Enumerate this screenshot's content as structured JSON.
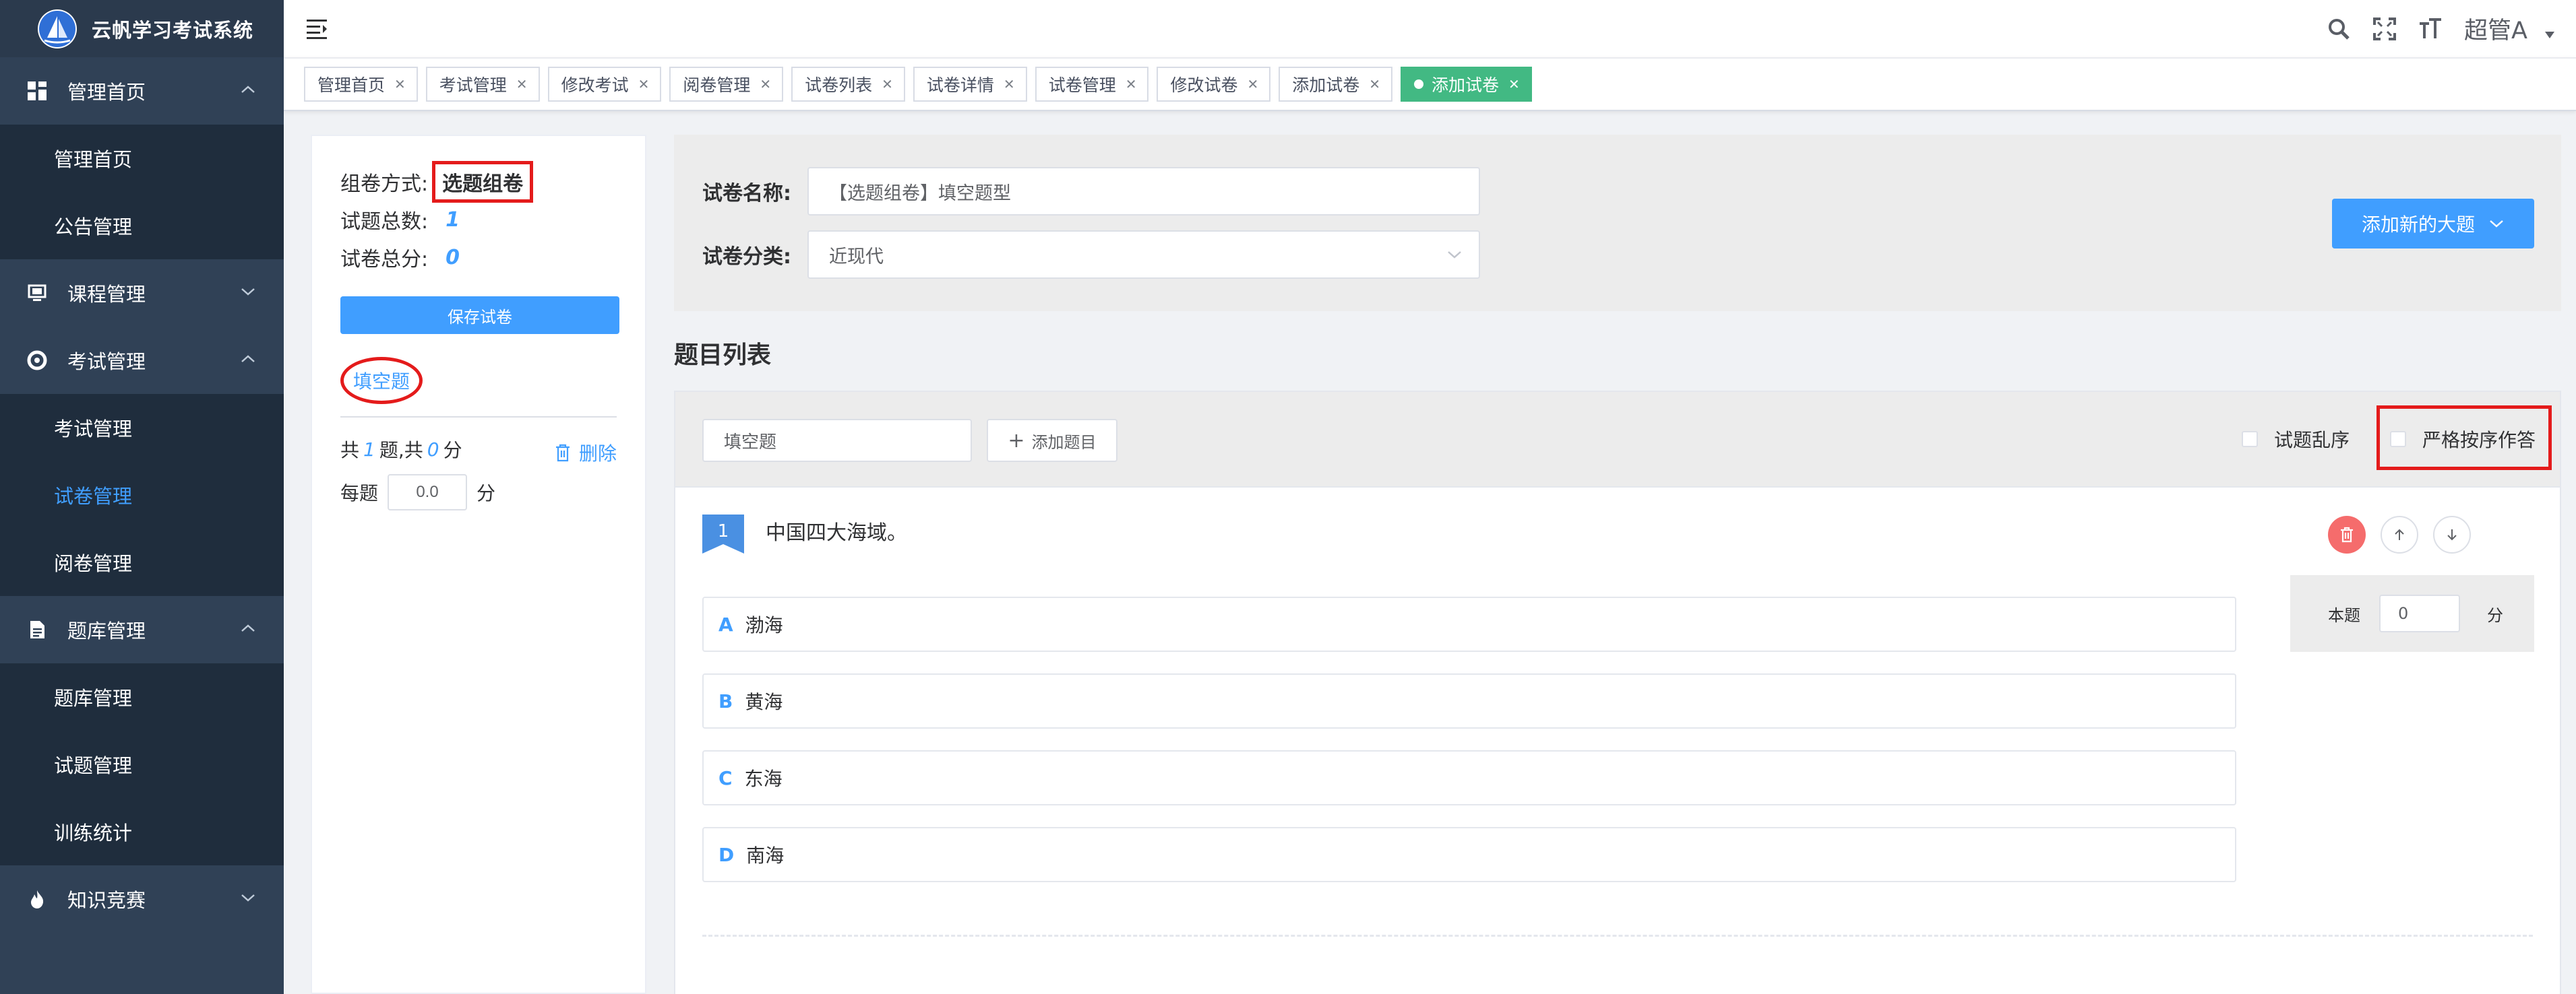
{
  "app": {
    "title": "云帆学习考试系统",
    "accent": "#409eff",
    "sidebar_bg": "#304156",
    "submenu_bg": "#1f2d3d",
    "tag_active_bg": "#42b983",
    "highlight_color": "#e41b1b"
  },
  "sidebar": {
    "groups": [
      {
        "label": "管理首页",
        "icon": "dashboard-icon",
        "expanded": true,
        "items": [
          {
            "label": "管理首页"
          },
          {
            "label": "公告管理"
          }
        ]
      },
      {
        "label": "课程管理",
        "icon": "monitor-icon",
        "expanded": false,
        "items": []
      },
      {
        "label": "考试管理",
        "icon": "lifebuoy-icon",
        "expanded": true,
        "items": [
          {
            "label": "考试管理"
          },
          {
            "label": "试卷管理",
            "active": true
          },
          {
            "label": "阅卷管理"
          }
        ]
      },
      {
        "label": "题库管理",
        "icon": "document-icon",
        "expanded": true,
        "items": [
          {
            "label": "题库管理"
          },
          {
            "label": "试题管理"
          },
          {
            "label": "训练统计"
          }
        ]
      },
      {
        "label": "知识竞赛",
        "icon": "fire-icon",
        "expanded": false,
        "items": []
      }
    ]
  },
  "navbar": {
    "user": "超管A",
    "icons": [
      "search-icon",
      "fullscreen-icon",
      "font-size-icon"
    ]
  },
  "tags": [
    {
      "label": "管理首页"
    },
    {
      "label": "考试管理"
    },
    {
      "label": "修改考试"
    },
    {
      "label": "阅卷管理"
    },
    {
      "label": "试卷列表"
    },
    {
      "label": "试卷详情"
    },
    {
      "label": "试卷管理"
    },
    {
      "label": "修改试卷"
    },
    {
      "label": "添加试卷"
    },
    {
      "label": "添加试卷",
      "active": true
    }
  ],
  "left_panel": {
    "method_label": "组卷方式:",
    "method_value": "选题组卷",
    "total_label": "试题总数:",
    "total_value": "1",
    "score_label": "试卷总分:",
    "score_value": "0",
    "save_label": "保存试卷",
    "qtype_label": "填空题",
    "count_prefix": "共",
    "count_num": "1",
    "count_mid": "题,共",
    "count_score": "0",
    "count_suffix": "分",
    "delete_label": "删除",
    "per_label": "每题",
    "per_value": "0.0",
    "per_unit": "分"
  },
  "form": {
    "name_label": "试卷名称:",
    "name_value": "【选题组卷】填空题型",
    "category_label": "试卷分类:",
    "category_value": "近现代",
    "add_section_label": "添加新的大题"
  },
  "question_list": {
    "title": "题目列表",
    "section_title_value": "填空题",
    "add_question_label": "添加题目",
    "shuffle_label": "试题乱序",
    "strict_order_label": "严格按序作答",
    "questions": [
      {
        "number": "1",
        "text": "中国四大海域。",
        "options": [
          {
            "letter": "A",
            "text": "渤海"
          },
          {
            "letter": "B",
            "text": "黄海"
          },
          {
            "letter": "C",
            "text": "东海"
          },
          {
            "letter": "D",
            "text": "南海"
          }
        ],
        "score_label": "本题",
        "score_value": "0",
        "score_unit": "分"
      }
    ]
  }
}
